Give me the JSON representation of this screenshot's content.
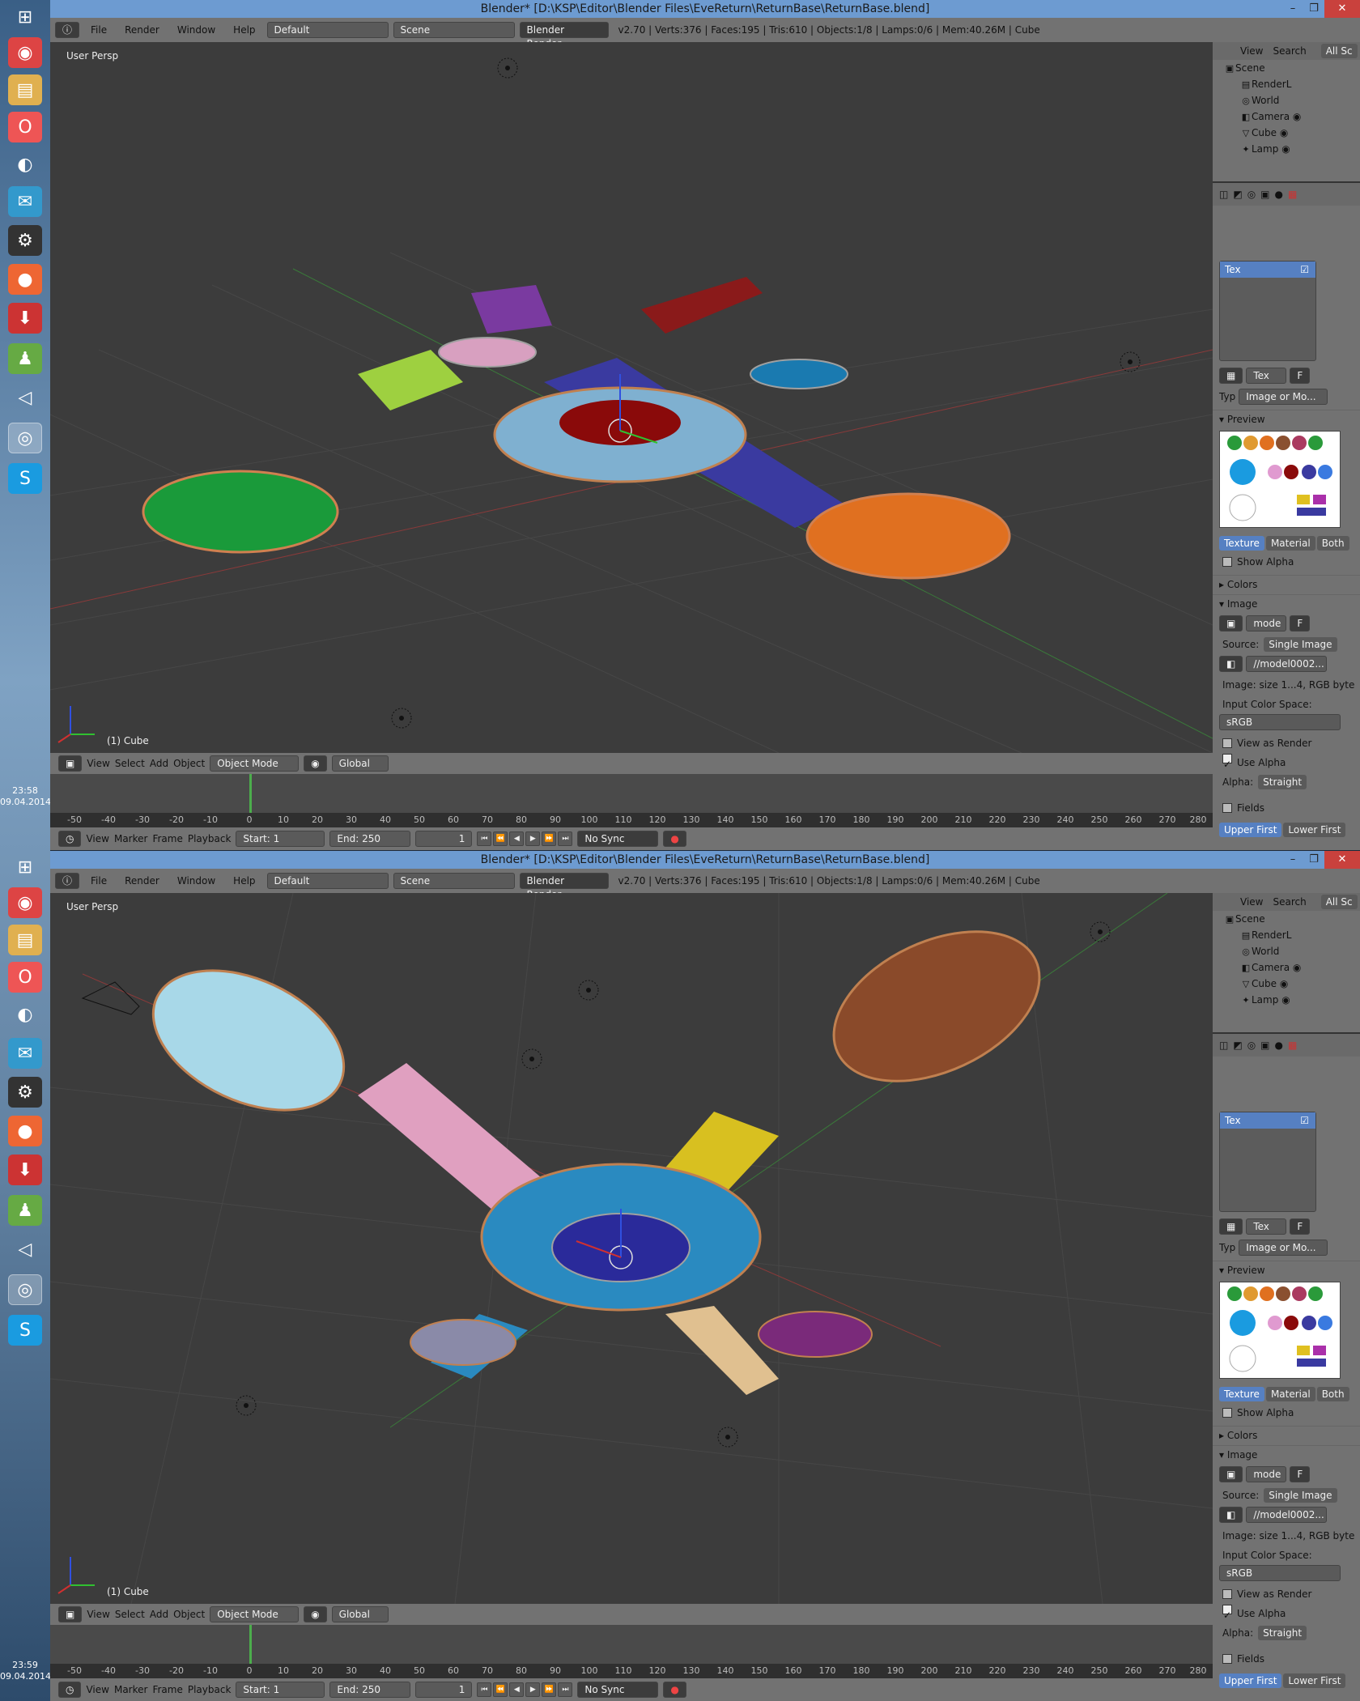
{
  "taskbar": {
    "icons": [
      "windows-start-icon",
      "chrome-icon",
      "file-explorer-icon",
      "opera-icon",
      "media-player-icon",
      "messenger-icon",
      "steam-icon",
      "app-icon",
      "download-icon",
      "kerbal-icon",
      "unity-icon",
      "blender-icon",
      "skype-icon"
    ],
    "clock_top": {
      "time": "23:58",
      "date": "09.04.2014"
    },
    "clock_bottom": {
      "time": "23:59",
      "date": "09.04.2014"
    }
  },
  "window": {
    "title": "Blender* [D:\\KSP\\Editor\\Blender Files\\EveReturn\\ReturnBase\\ReturnBase.blend]",
    "minimize": "–",
    "restore": "❐",
    "close": "✕"
  },
  "infobar": {
    "menus": [
      "File",
      "Render",
      "Window",
      "Help"
    ],
    "layout": "Default",
    "scene": "Scene",
    "engine": "Blender Render",
    "stats": "v2.70 | Verts:376 | Faces:195 | Tris:610 | Objects:1/8 | Lamps:0/6 | Mem:40.26M | Cube"
  },
  "viewport": {
    "label": "User Persp",
    "object_name": "(1) Cube",
    "colors": {
      "bg": "#3c3c3c",
      "grid": "#4a4a4a"
    }
  },
  "view3d_header": {
    "menus": [
      "View",
      "Select",
      "Add",
      "Object"
    ],
    "mode": "Object Mode",
    "orientation": "Global"
  },
  "timeline": {
    "ruler": [
      "-50",
      "-40",
      "-30",
      "-20",
      "-10",
      "0",
      "10",
      "20",
      "30",
      "40",
      "50",
      "60",
      "70",
      "80",
      "90",
      "100",
      "110",
      "120",
      "130",
      "140",
      "150",
      "160",
      "170",
      "180",
      "190",
      "200",
      "210",
      "220",
      "230",
      "240",
      "250",
      "260",
      "270",
      "280"
    ],
    "menus": [
      "View",
      "Marker",
      "Frame",
      "Playback"
    ],
    "start": "Start:",
    "start_val": "1",
    "end": "End:",
    "end_val": "250",
    "current": "1",
    "sync": "No Sync"
  },
  "outliner": {
    "menus": [
      "View",
      "Search",
      "All Sc"
    ],
    "items": [
      {
        "label": "Scene",
        "icon": "scene-icon"
      },
      {
        "label": "RenderL",
        "icon": "render-layer-icon"
      },
      {
        "label": "World",
        "icon": "world-icon"
      },
      {
        "label": "Camera",
        "icon": "camera-icon"
      },
      {
        "label": "Cube",
        "icon": "mesh-icon"
      },
      {
        "label": "Lamp",
        "icon": "lamp-icon"
      }
    ]
  },
  "properties": {
    "tex_slot": "Tex",
    "tex_name": "Tex",
    "f_label": "F",
    "type_label": "Typ",
    "type_value": "Image or Mo...",
    "preview": "Preview",
    "preview_modes": [
      "Texture",
      "Material",
      "Both"
    ],
    "show_alpha": "Show Alpha",
    "colors": "Colors",
    "image": "Image",
    "image_name": "mode",
    "source_label": "Source:",
    "source_value": "Single Image",
    "file_path": "//model0002...",
    "image_size": "Image: size 1...4, RGB byte",
    "color_space_label": "Input Color Space:",
    "color_space": "sRGB",
    "view_as_render": "View as Render",
    "use_alpha": "Use Alpha",
    "alpha_label": "Alpha:",
    "alpha_value": "Straight",
    "fields": "Fields",
    "field_order": [
      "Upper First",
      "Lower First"
    ]
  }
}
